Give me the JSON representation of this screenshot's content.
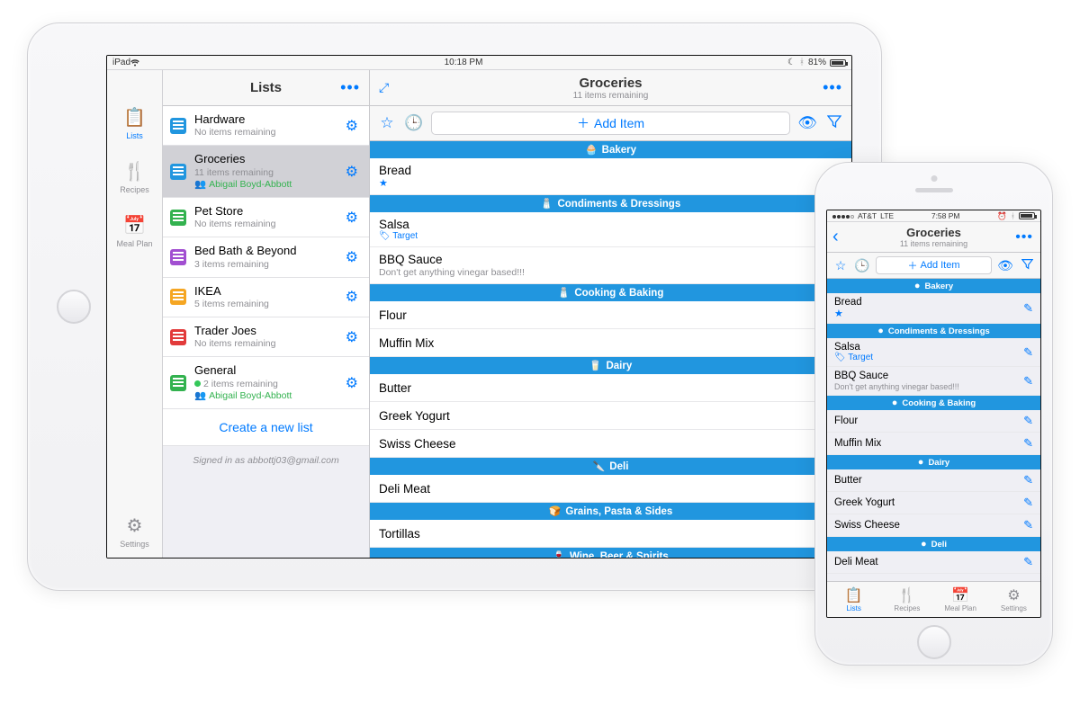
{
  "ipad": {
    "status": {
      "device": "iPad",
      "time": "10:18 PM",
      "battery": "81%"
    },
    "nav": [
      {
        "label": "Lists",
        "icon": "list",
        "active": true
      },
      {
        "label": "Recipes",
        "icon": "recipes"
      },
      {
        "label": "Meal Plan",
        "icon": "calendar"
      },
      {
        "label": "Settings",
        "icon": "gear",
        "bottom": true
      }
    ],
    "lists_title": "Lists",
    "lists": [
      {
        "name": "Hardware",
        "sub": "No items remaining",
        "color": "#2196df"
      },
      {
        "name": "Groceries",
        "sub": "11 items remaining",
        "shared": "Abigail Boyd-Abbott",
        "color": "#2196df",
        "selected": true
      },
      {
        "name": "Pet Store",
        "sub": "No items remaining",
        "color": "#33b24f"
      },
      {
        "name": "Bed Bath & Beyond",
        "sub": "3 items remaining",
        "color": "#a24fd1"
      },
      {
        "name": "IKEA",
        "sub": "5 items remaining",
        "color": "#f5a623"
      },
      {
        "name": "Trader Joes",
        "sub": "No items remaining",
        "color": "#e23b3b"
      },
      {
        "name": "General",
        "sub": "2 items remaining",
        "shared": "Abigail Boyd-Abbott",
        "unread": true,
        "color": "#33b24f"
      }
    ],
    "create_label": "Create a new list",
    "signed_in": "Signed in as abbottj03@gmail.com"
  },
  "detail": {
    "title": "Groceries",
    "subtitle": "11 items remaining",
    "add_item_label": "Add Item",
    "sections": [
      {
        "name": "Bakery",
        "icon": "🧁",
        "items": [
          {
            "name": "Bread",
            "star": true
          }
        ]
      },
      {
        "name": "Condiments & Dressings",
        "icon": "🧂",
        "items": [
          {
            "name": "Salsa",
            "store": "Target"
          },
          {
            "name": "BBQ Sauce",
            "note": "Don't get anything vinegar based!!!"
          }
        ]
      },
      {
        "name": "Cooking & Baking",
        "icon": "🧂",
        "items": [
          {
            "name": "Flour"
          },
          {
            "name": "Muffin Mix"
          }
        ]
      },
      {
        "name": "Dairy",
        "icon": "🥛",
        "items": [
          {
            "name": "Butter"
          },
          {
            "name": "Greek Yogurt"
          },
          {
            "name": "Swiss Cheese"
          }
        ]
      },
      {
        "name": "Deli",
        "icon": "🔪",
        "items": [
          {
            "name": "Deli Meat"
          }
        ]
      },
      {
        "name": "Grains, Pasta & Sides",
        "icon": "🍞",
        "items": [
          {
            "name": "Tortillas"
          }
        ]
      },
      {
        "name": "Wine, Beer & Spirits",
        "icon": "🍷",
        "items": []
      }
    ]
  },
  "iphone": {
    "status": {
      "carrier": "AT&T",
      "net": "LTE",
      "time": "7:58 PM"
    },
    "title": "Groceries",
    "subtitle": "11 items remaining",
    "add_item_label": "Add Item",
    "sections": [
      {
        "name": "Bakery",
        "items": [
          {
            "name": "Bread",
            "star": true
          }
        ]
      },
      {
        "name": "Condiments & Dressings",
        "items": [
          {
            "name": "Salsa",
            "store": "Target"
          },
          {
            "name": "BBQ Sauce",
            "note": "Don't get anything vinegar based!!!"
          }
        ]
      },
      {
        "name": "Cooking & Baking",
        "items": [
          {
            "name": "Flour"
          },
          {
            "name": "Muffin Mix"
          }
        ]
      },
      {
        "name": "Dairy",
        "items": [
          {
            "name": "Butter"
          },
          {
            "name": "Greek Yogurt"
          },
          {
            "name": "Swiss Cheese"
          }
        ]
      },
      {
        "name": "Deli",
        "items": [
          {
            "name": "Deli Meat"
          }
        ]
      }
    ],
    "tabs": [
      {
        "label": "Lists",
        "active": true
      },
      {
        "label": "Recipes"
      },
      {
        "label": "Meal Plan"
      },
      {
        "label": "Settings"
      }
    ]
  }
}
